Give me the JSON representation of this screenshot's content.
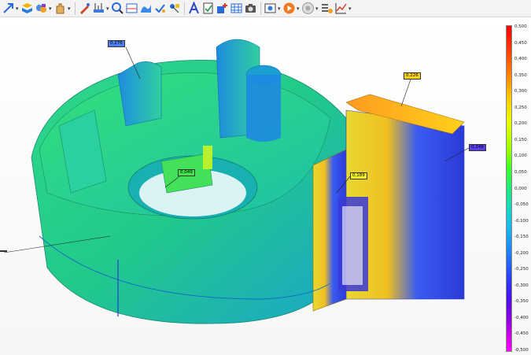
{
  "toolbar": {
    "items": [
      {
        "icon": "expand-arrow-icon",
        "dropdown": true
      },
      {
        "icon": "cube-layers-icon",
        "dropdown": false
      },
      {
        "icon": "measure-cluster-icon",
        "dropdown": true
      },
      {
        "icon": "hand-icon",
        "dropdown": true
      },
      {
        "icon": "probe-pen-icon",
        "dropdown": false
      },
      {
        "icon": "scale-tool-icon",
        "dropdown": true
      },
      {
        "icon": "zoom-icon",
        "dropdown": false
      },
      {
        "icon": "section-view-icon",
        "dropdown": false
      },
      {
        "icon": "surface-shape-icon",
        "dropdown": false
      },
      {
        "icon": "check-point-icon",
        "dropdown": false
      },
      {
        "icon": "point-select-icon",
        "dropdown": false
      },
      {
        "icon": "annotation-a-icon",
        "dropdown": false
      },
      {
        "icon": "report-check-icon",
        "dropdown": false
      },
      {
        "icon": "add-feature-icon",
        "dropdown": false
      },
      {
        "icon": "table-grid-icon",
        "dropdown": false
      },
      {
        "icon": "camera-icon",
        "dropdown": false
      },
      {
        "icon": "view-settings-icon",
        "dropdown": true
      },
      {
        "icon": "play-icon",
        "dropdown": true
      },
      {
        "icon": "record-icon",
        "dropdown": true
      },
      {
        "icon": "list-settings-icon",
        "dropdown": false
      },
      {
        "icon": "line-chart-icon",
        "dropdown": true
      }
    ],
    "dropdown_glyph": "▾"
  },
  "panel_control": "▪ ▾",
  "callouts": [
    {
      "id": "c1",
      "value": "0,276",
      "bg": "#4f7ff0"
    },
    {
      "id": "c2",
      "value": "0,226",
      "bg": "#ffd21a"
    },
    {
      "id": "c3",
      "value": "0,349",
      "bg": "#5a3ff0"
    },
    {
      "id": "c4",
      "value": "0,049",
      "bg": "#3ee64a"
    },
    {
      "id": "c5",
      "value": "0,189",
      "bg": "#f4f020"
    },
    {
      "id": "c6",
      "value": "",
      "bg": "#2fd6b0"
    }
  ],
  "colorbar": {
    "max": "0,500",
    "min": "-0,500",
    "ticks": [
      "0,500",
      "0,450",
      "0,400",
      "0,350",
      "0,300",
      "0,250",
      "0,200",
      "0,150",
      "0,100",
      "0,050",
      "0,000",
      "-0,050",
      "-0,100",
      "-0,150",
      "-0,200",
      "-0,250",
      "-0,300",
      "-0,350",
      "-0,400",
      "-0,450",
      "-0,500"
    ]
  },
  "colors": {
    "nominal": "#22d27c",
    "positive": "#ffd21a",
    "negative": "#2a45e8"
  }
}
